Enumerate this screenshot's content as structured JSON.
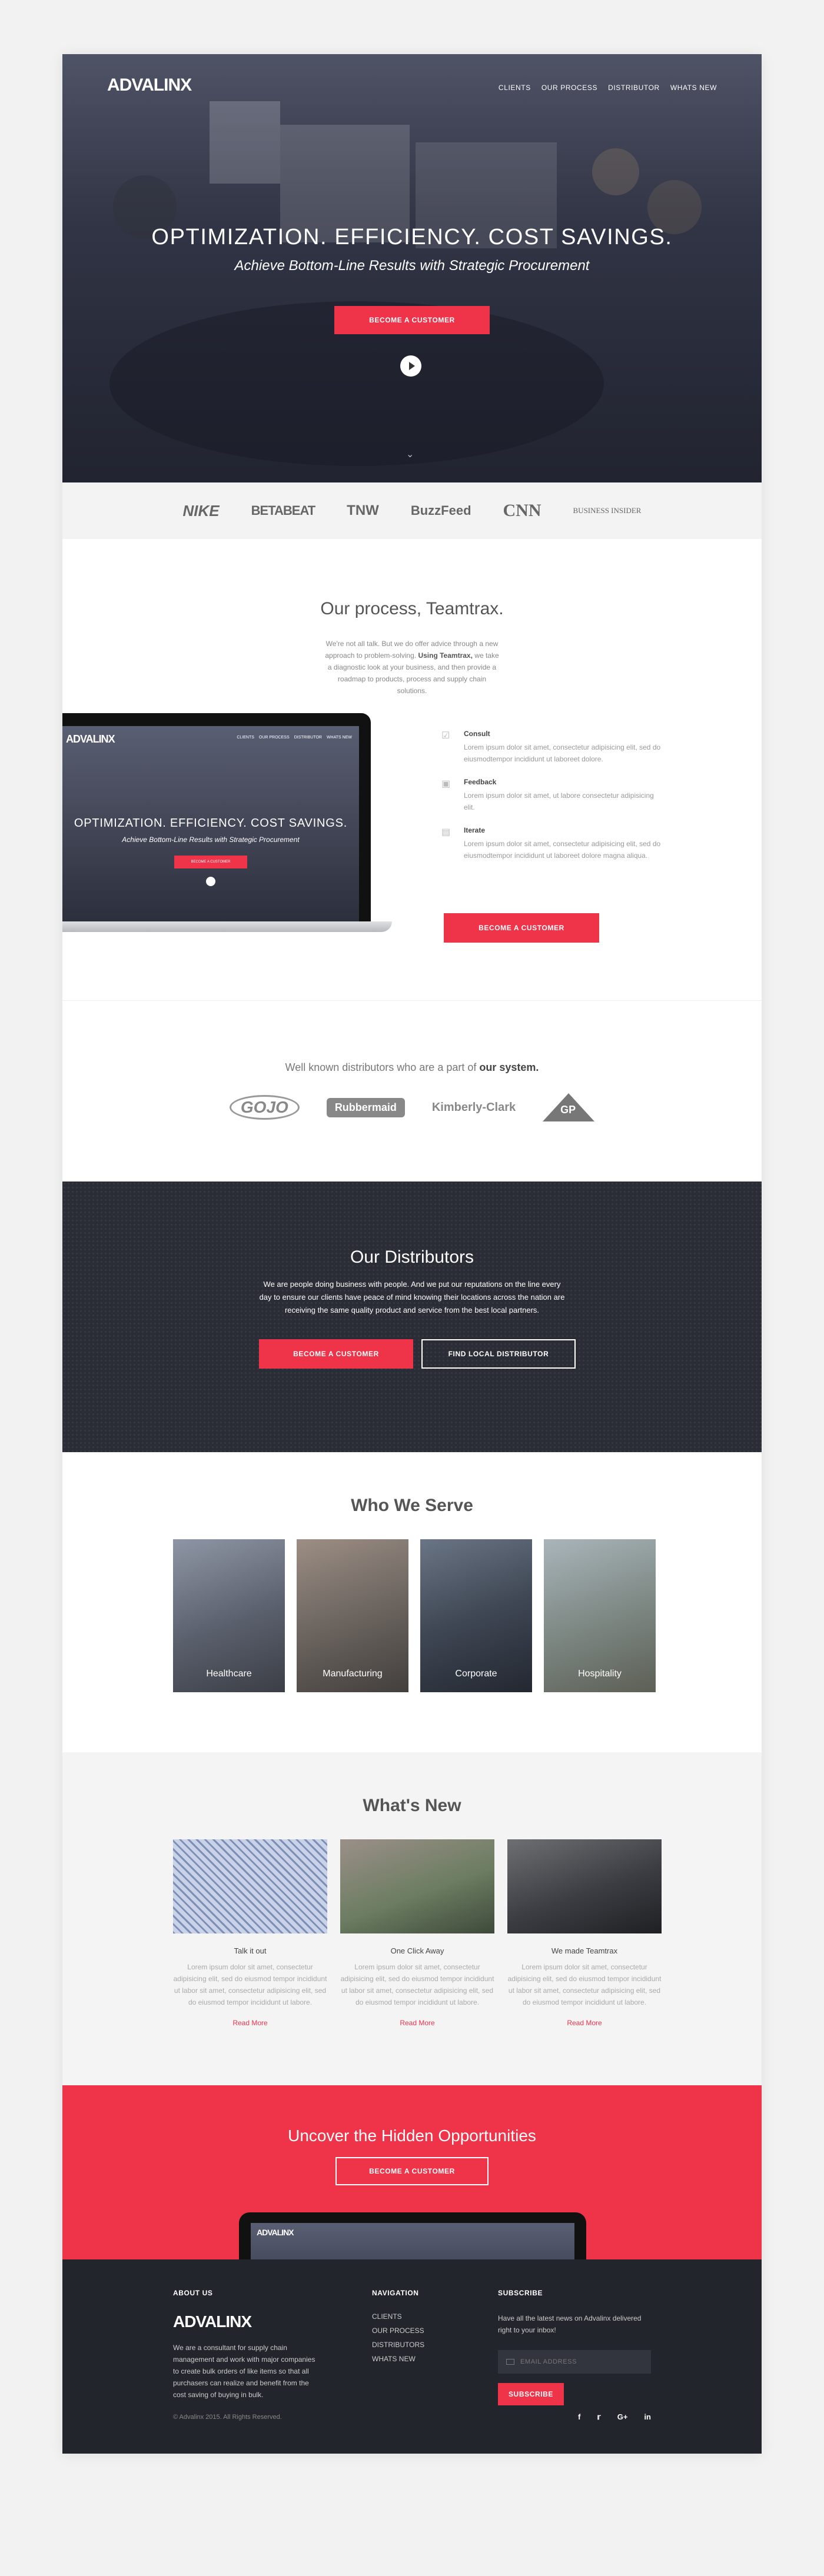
{
  "brand": "ADVALINX",
  "hero": {
    "nav": [
      "CLIENTS",
      "OUR PROCESS",
      "DISTRIBUTOR",
      "WHATS NEW"
    ],
    "headline": "OPTIMIZATION. EFFICIENCY. COST SAVINGS.",
    "subheadline": "Achieve Bottom-Line Results with Strategic Procurement",
    "cta": "BECOME A CUSTOMER"
  },
  "press": {
    "logos": [
      "NIKE",
      "BETABEAT",
      "TNW",
      "BuzzFeed",
      "CNN",
      "BUSINESS INSIDER"
    ]
  },
  "process": {
    "title": "Our process, Teamtrax.",
    "intro": "We're not all talk. But we do offer advice through a new approach to problem-solving.",
    "intro_bold": "Using Teamtrax,",
    "intro_rest": "we take a diagnostic look at your business, and then provide a roadmap to products, process and supply chain solutions.",
    "laptop": {
      "nav": [
        "CLIENTS",
        "OUR PROCESS",
        "DISTRIBUTOR",
        "WHATS NEW"
      ],
      "headline": "OPTIMIZATION. EFFICIENCY. COST SAVINGS.",
      "subheadline": "Achieve Bottom-Line Results with Strategic Procurement",
      "cta": "BECOME A CUSTOMER"
    },
    "steps": [
      {
        "title": "Consult",
        "text": "Lorem ipsum dolor sit amet, consectetur adipisicing elit, sed do eiusmodtempor incididunt ut laboreet dolore."
      },
      {
        "title": "Feedback",
        "text": "Lorem ipsum dolor sit amet, ut labore consectetur adipisicing elit."
      },
      {
        "title": "Iterate",
        "text": "Lorem ipsum dolor sit amet, consectetur adipisicing elit, sed do eiusmodtempor incididunt ut laboreet dolore magna aliqua."
      }
    ],
    "cta": "BECOME A CUSTOMER"
  },
  "partners": {
    "title": "Well known distributors who are a part of",
    "title_bold": "our system.",
    "logos": [
      "GOJO",
      "Rubbermaid",
      "Kimberly-Clark",
      "GP"
    ]
  },
  "distributors": {
    "title": "Our Distributors",
    "text": "We are people doing business with people. And we put our reputations on the line every day to ensure our clients have peace of mind knowing their locations across the nation are receiving the same quality product and service from the best local partners.",
    "cta_primary": "BECOME A CUSTOMER",
    "cta_secondary": "FIND LOCAL DISTRIBUTOR"
  },
  "serve": {
    "title": "Who We Serve",
    "tiles": [
      "Healthcare",
      "Manufacturing",
      "Corporate",
      "Hospitality"
    ]
  },
  "news": {
    "title": "What's New",
    "posts": [
      {
        "title": "Talk it out",
        "text": "Lorem ipsum dolor sit amet, consectetur adipisicing elit, sed do eiusmod tempor incididunt ut labor sit amet, consectetur adipisicing elit, sed do eiusmod tempor incididunt ut labore.",
        "link": "Read More"
      },
      {
        "title": "One Click Away",
        "text": "Lorem ipsum dolor sit amet, consectetur adipisicing elit, sed do eiusmod tempor incididunt ut labor sit amet, consectetur adipisicing elit, sed do eiusmod tempor incididunt ut labore.",
        "link": "Read More"
      },
      {
        "title": "We made Teamtrax",
        "text": "Lorem ipsum dolor sit amet, consectetur adipisicing elit, sed do eiusmod tempor incididunt ut labor sit amet, consectetur adipisicing elit, sed do eiusmod tempor incididunt ut labore.",
        "link": "Read More"
      }
    ]
  },
  "cta_band": {
    "title": "Uncover the Hidden Opportunities",
    "cta": "BECOME A CUSTOMER"
  },
  "footer": {
    "about_heading": "ABOUT US",
    "about_text": "We are a consultant for supply chain management and work with major companies to create bulk orders of like items so that all purchasers can realize and benefit from the cost saving of buying in bulk.",
    "nav_heading": "NAVIGATION",
    "nav": [
      "CLIENTS",
      "OUR PROCESS",
      "DISTRIBUTORS",
      "WHATS NEW"
    ],
    "subscribe_heading": "SUBSCRIBE",
    "subscribe_text": "Have all the latest news on Advalinx delivered right to your inbox!",
    "email_placeholder": "EMAIL ADDRESS",
    "subscribe_button": "SUBSCRIBE",
    "copyright": "© Advalinx 2015. All Rights Reserved.",
    "social": [
      "f",
      "t",
      "G+",
      "in"
    ]
  },
  "colors": {
    "accent": "#ef3349",
    "dark": "#2b2d36",
    "footer": "#23252c"
  }
}
